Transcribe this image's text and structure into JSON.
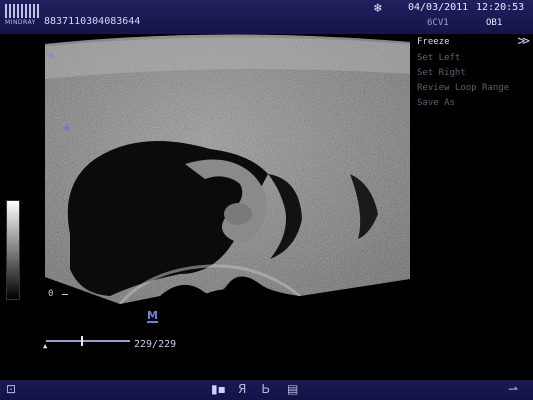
{
  "header": {
    "logo_text": "MINDRAY",
    "patient_id": "8837110304083644",
    "freeze_icon": "snowflake-icon",
    "date": "04/03/2011",
    "time": "12:20:53",
    "probe": "6CV1",
    "exam_mode": "OB1"
  },
  "menu": {
    "title": "Freeze",
    "expand_icon": "double-chevron-right-icon",
    "items": [
      "Set Left",
      "Set Right",
      "Review Loop Range",
      "Save As"
    ]
  },
  "image": {
    "depth_zero": "0",
    "marker": "M"
  },
  "cine": {
    "frames_label": "229/229",
    "position_fraction": 0.42
  },
  "footer": {
    "icons": [
      "screen-icon",
      "probe-switch-icon",
      "letter-r-icon",
      "letter-b-icon",
      "document-icon",
      "usb-icon"
    ]
  },
  "colors": {
    "bar_bg": "#1a1a52",
    "menu_disabled": "#5d5f72",
    "text": "#c9cbe6"
  }
}
